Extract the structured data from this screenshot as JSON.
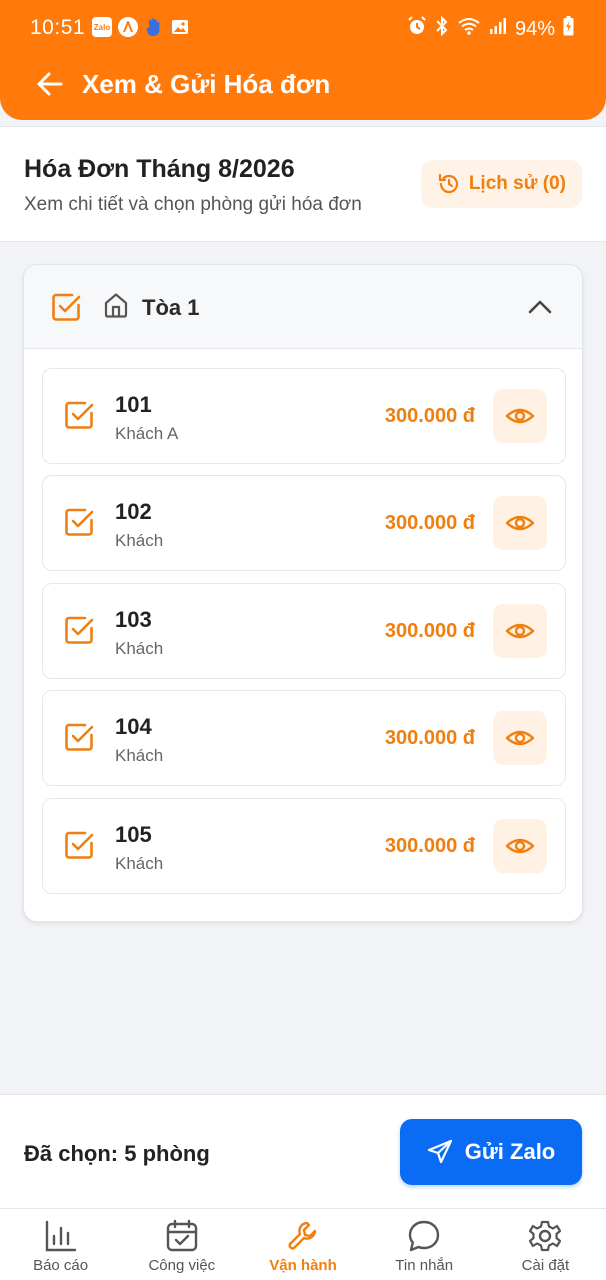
{
  "status_bar": {
    "time": "10:51",
    "battery": "94%",
    "app_icons": [
      "zalo-icon",
      "app-a-icon",
      "hand-icon",
      "image-icon"
    ],
    "system_icons": [
      "alarm-icon",
      "bluetooth-icon",
      "wifi-icon",
      "signal-icon",
      "battery-icon"
    ]
  },
  "header": {
    "title": "Xem & Gửi Hóa đơn",
    "back_icon": "arrow-left-icon",
    "background_color": "#ff7a0a"
  },
  "invoice": {
    "title": "Hóa Đơn Tháng 8/2026",
    "subtitle": "Xem chi tiết và chọn phòng gửi hóa đơn",
    "history_label": "Lịch sử (0)"
  },
  "building": {
    "name": "Tòa 1",
    "checked": true,
    "expanded": true,
    "rooms": [
      {
        "number": "101",
        "tenant": "Khách A",
        "amount": "300.000 đ",
        "checked": true
      },
      {
        "number": "102",
        "tenant": "Khách",
        "amount": "300.000 đ",
        "checked": true
      },
      {
        "number": "103",
        "tenant": "Khách",
        "amount": "300.000 đ",
        "checked": true
      },
      {
        "number": "104",
        "tenant": "Khách",
        "amount": "300.000 đ",
        "checked": true
      },
      {
        "number": "105",
        "tenant": "Khách",
        "amount": "300.000 đ",
        "checked": true
      }
    ]
  },
  "footer": {
    "selected_text": "Đã chọn: 5 phòng",
    "send_label": "Gửi Zalo",
    "send_color": "#0a6cf5"
  },
  "nav": {
    "items": [
      {
        "label": "Báo cáo",
        "icon": "bar-chart-icon",
        "active": false
      },
      {
        "label": "Công việc",
        "icon": "calendar-check-icon",
        "active": false
      },
      {
        "label": "Vận hành",
        "icon": "wrench-icon",
        "active": true
      },
      {
        "label": "Tin nhắn",
        "icon": "chat-bubble-icon",
        "active": false
      },
      {
        "label": "Cài đặt",
        "icon": "gear-icon",
        "active": false
      }
    ]
  },
  "colors": {
    "accent": "#f07f10",
    "accent_bg": "#fff1e4"
  }
}
